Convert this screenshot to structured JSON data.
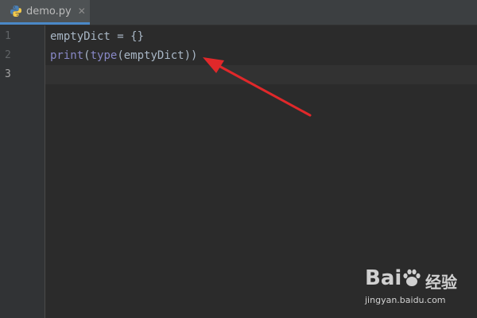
{
  "tab": {
    "label": "demo.py",
    "close_glyph": "✕",
    "icon": "python-file-icon"
  },
  "gutter": {
    "line_numbers": [
      "1",
      "2",
      "3"
    ],
    "active_line": "3"
  },
  "code": {
    "line1": "emptyDict = {}",
    "line2_builtin_print": "print",
    "line2_paren1": "(",
    "line2_builtin_type": "type",
    "line2_rest": "(emptyDict))"
  },
  "annotation": {
    "arrow_color": "#e0282a"
  },
  "watermark": {
    "logo_text": "Bai",
    "product": "经验",
    "url": "jingyan.baidu.com"
  },
  "colors": {
    "editor_bg": "#2b2b2b",
    "gutter_bg": "#313335",
    "tab_active_underline": "#4a88c7",
    "code_text": "#a9b7c6",
    "builtin": "#8888c6"
  }
}
